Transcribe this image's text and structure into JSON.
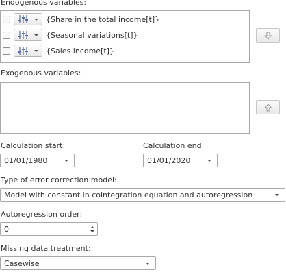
{
  "endogenous": {
    "label": "Endogenous variables:",
    "items": [
      {
        "text": "{Share in the total income[t]}",
        "checked": false
      },
      {
        "text": "{Seasonal variations[t]}",
        "checked": false
      },
      {
        "text": "{Sales income[t]}",
        "checked": false
      }
    ],
    "move_down_icon": "arrow-down-icon"
  },
  "exogenous": {
    "label": "Exogenous variables:",
    "move_up_icon": "arrow-up-icon"
  },
  "calc_start": {
    "label": "Calculation start:",
    "value": "01/01/1980"
  },
  "calc_end": {
    "label": "Calculation end:",
    "value": "01/01/2020"
  },
  "error_model": {
    "label": "Type of error correction model:",
    "value": "Model with constant in cointegration equation and autoregression"
  },
  "autoregression": {
    "label": "Autoregression order:",
    "value": "0"
  },
  "missing": {
    "label": "Missing data treatment:",
    "value": "Casewise"
  },
  "colors": {
    "border": "#a9a9a9",
    "text": "#333333",
    "icon": "#5a6fa0"
  }
}
